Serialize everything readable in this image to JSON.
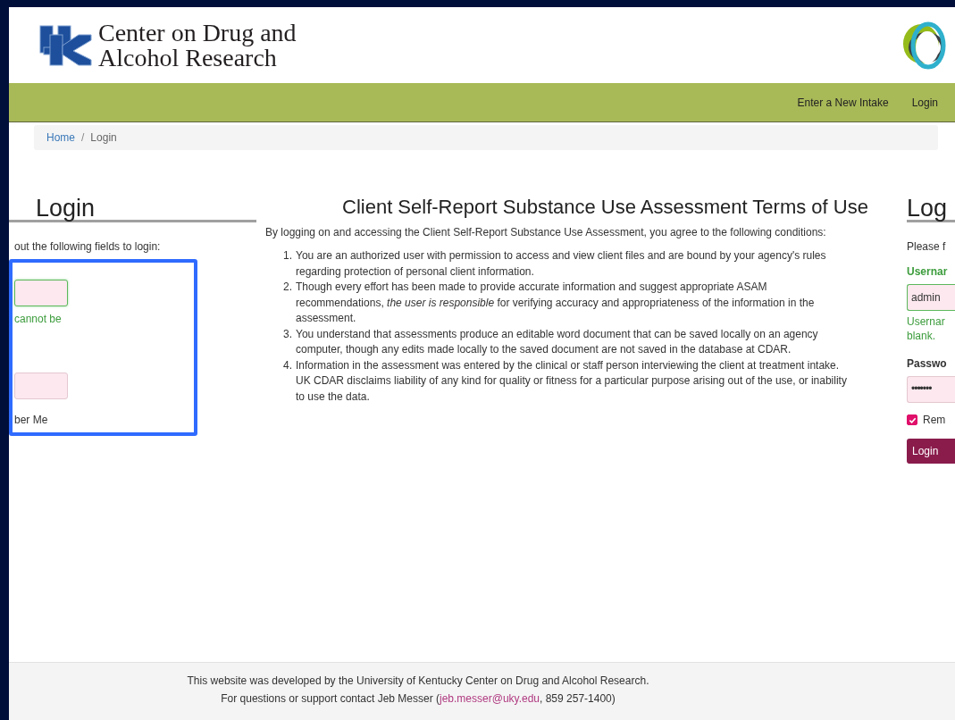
{
  "header": {
    "title_lines": [
      "Center on Drug and",
      "Alcohol Research"
    ]
  },
  "nav": {
    "items": [
      {
        "label": "Enter a New Intake"
      },
      {
        "label": "Login"
      }
    ]
  },
  "breadcrumb": [
    {
      "label": "Home",
      "kind": "link"
    },
    {
      "label": "/",
      "kind": "separator"
    },
    {
      "label": "Login",
      "kind": "current"
    }
  ],
  "left_panel": {
    "heading": "Login",
    "intro": "out the following fields to login:",
    "username_valid": true,
    "username_help": "cannot be",
    "remember_label": "ber Me",
    "selection_box": true
  },
  "terms": {
    "heading": "Client Self-Report Substance Use Assessment Terms of Use",
    "intro": "By logging on and accessing the Client Self-Report Substance Use Assessment, you agree to the following conditions:",
    "items": [
      {
        "number": "1.",
        "text": "You are an authorized user with permission to access and view client files and are bound by your agency's rules regarding protection of personal client information."
      },
      {
        "number": "2.",
        "text": "Though every effort has been made to provide accurate information and suggest appropriate ASAM recommendations, *the user is responsible* for verifying accuracy and appropriateness of the information in the assessment."
      },
      {
        "number": "3.",
        "text": "You understand that assessments produce an editable word document that can be saved locally on an agency computer, though any edits made locally to the saved document are not saved in the database at CDAR."
      },
      {
        "number": "4.",
        "text": "Information in the assessment was entered by the clinical or staff person interviewing the client at treatment intake. UK CDAR disclaims liability of any kind for quality or fitness for a particular purpose arising out of the use, or inability to use the data."
      }
    ]
  },
  "right_panel": {
    "heading": "Log",
    "intro": "Please f",
    "username_label": "Usernar",
    "username_value": "admin",
    "username_valid": true,
    "username_help": [
      "Usernar",
      "blank."
    ],
    "password_label": "Passwo",
    "password_value": "•••••••",
    "remember": {
      "label": "Rem",
      "checked": true
    },
    "button": "Login"
  },
  "footer": {
    "line1": "This website was developed by the University of Kentucky Center on Drug and Alcohol Research.",
    "line2_before": "For questions or support contact Jeb Messer (",
    "email": "jeb.messer@uky.edu",
    "line2_after": ", 859 257-1400)"
  }
}
